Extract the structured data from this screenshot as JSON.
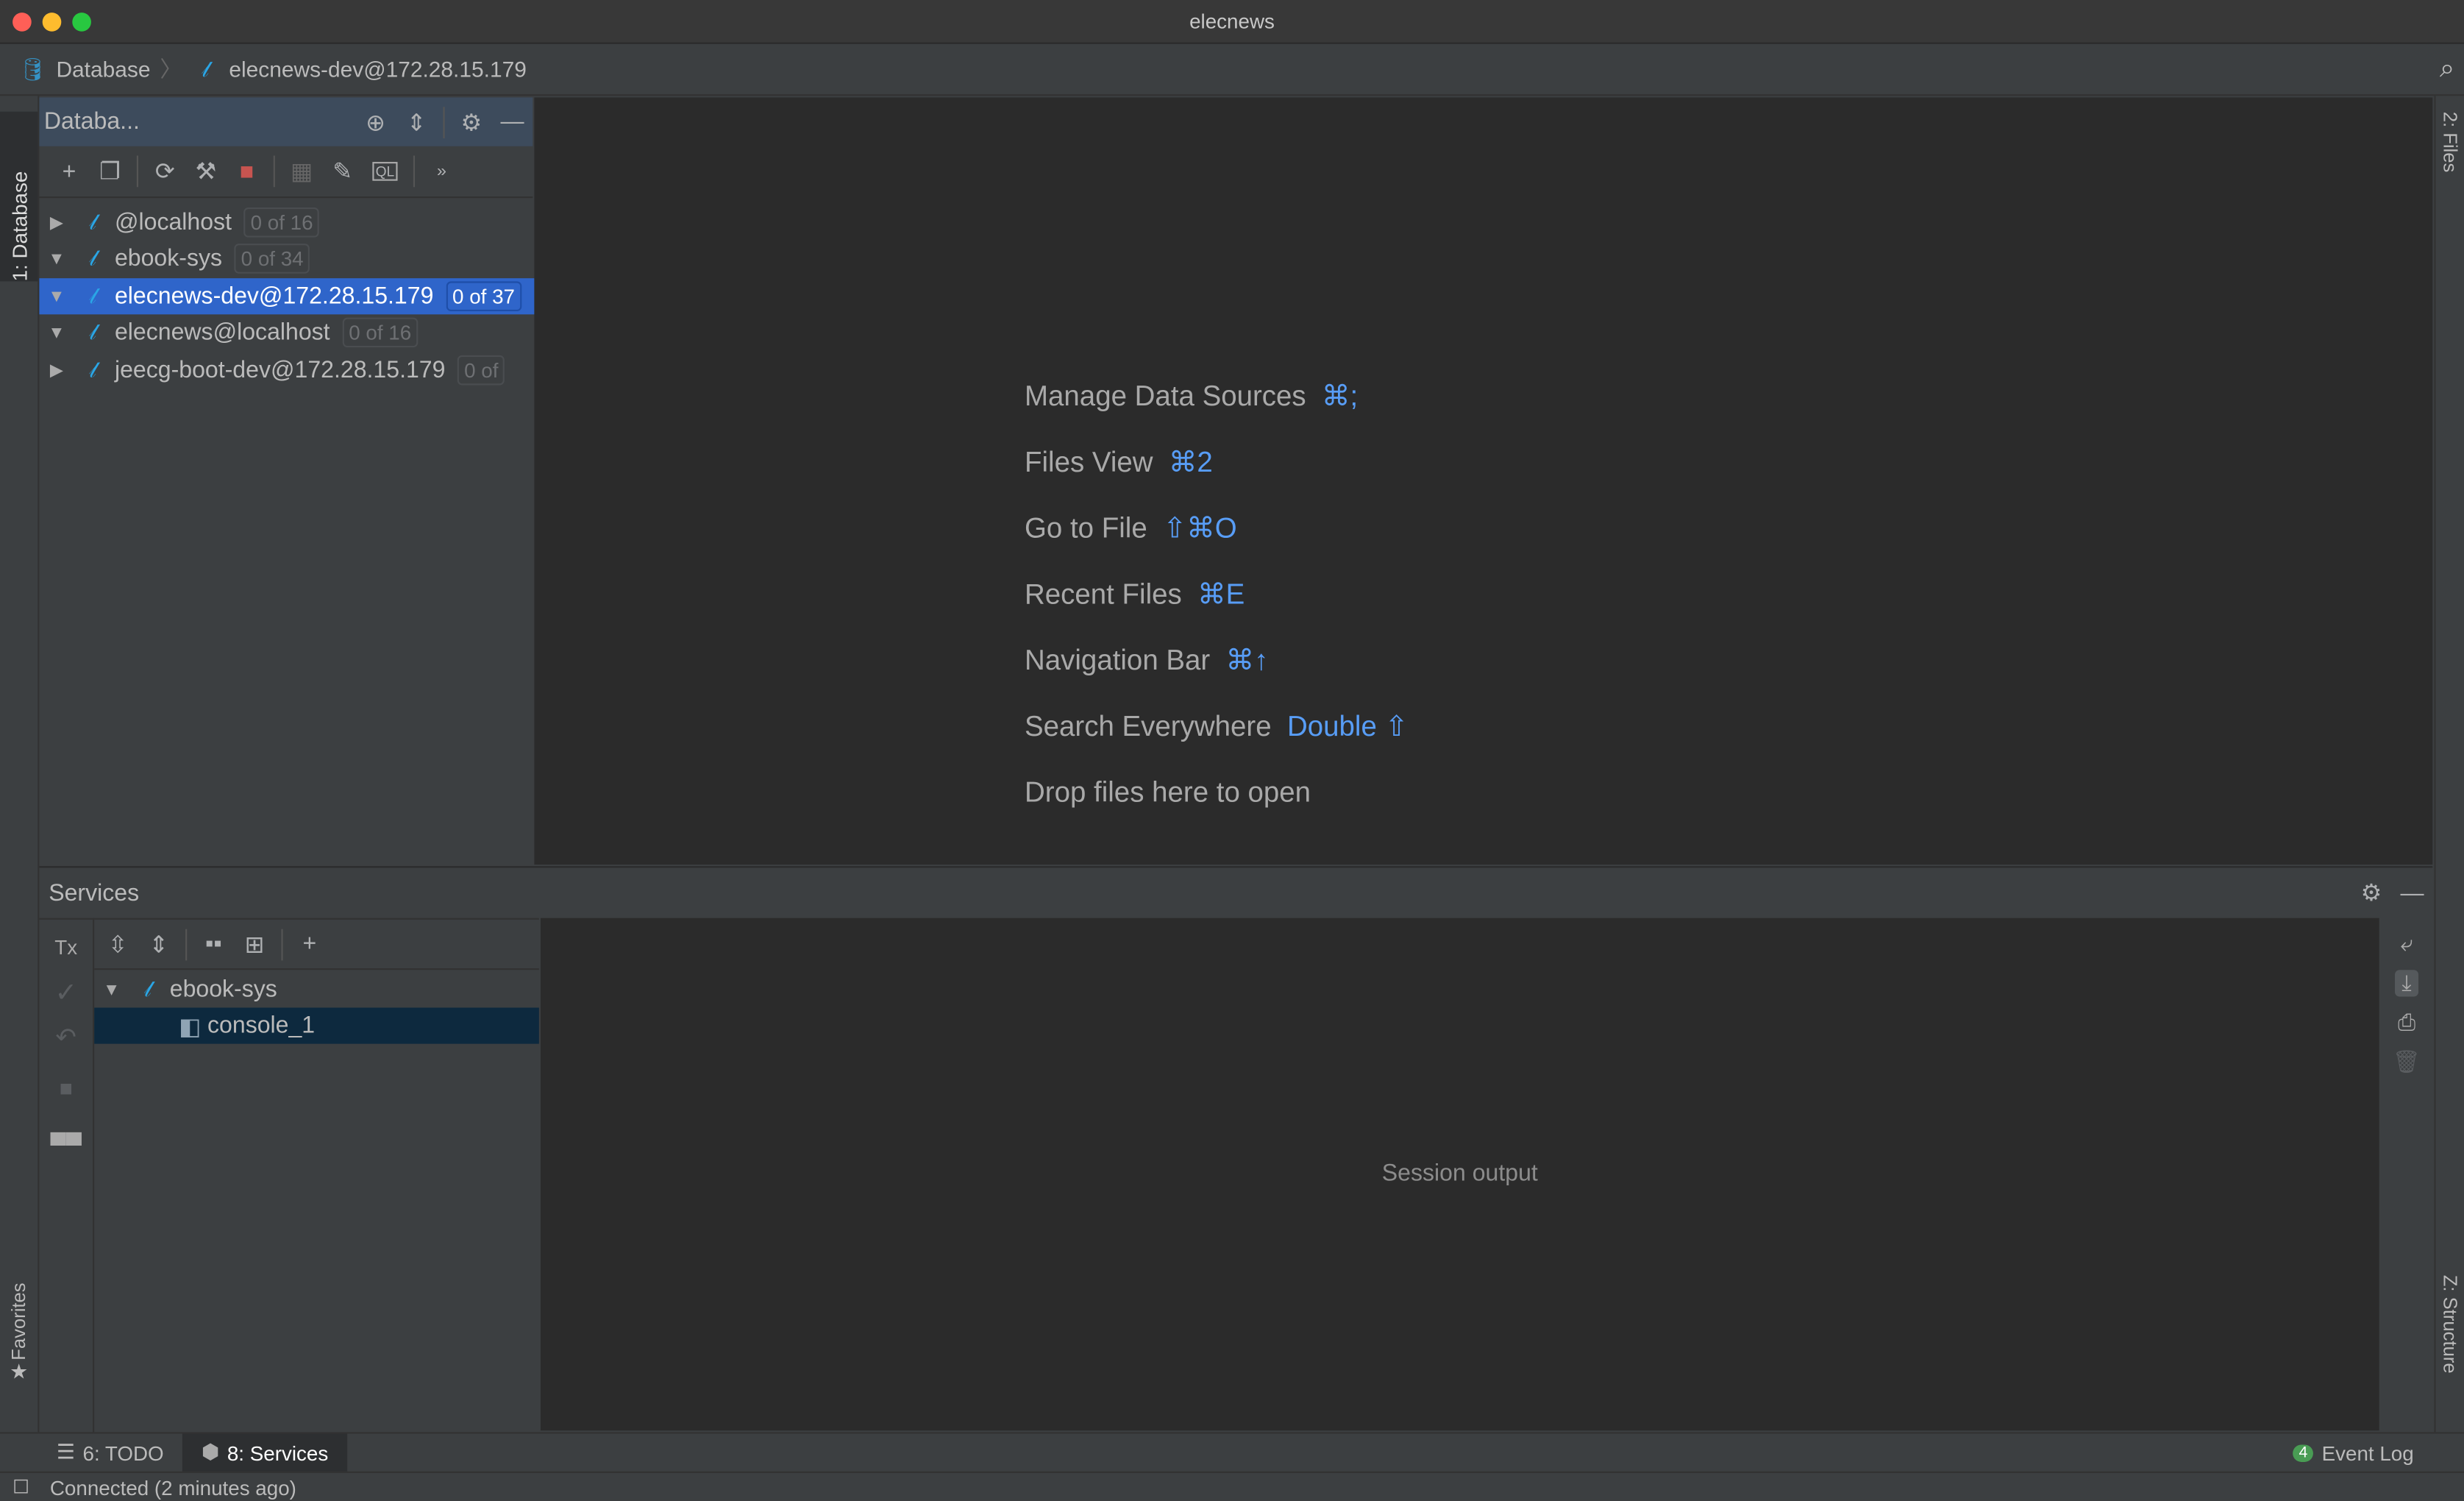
{
  "window": {
    "title": "elecnews"
  },
  "navbar": {
    "crumbs": [
      "Database",
      "elecnews-dev@172.28.15.179"
    ]
  },
  "left_stripe": {
    "database_tab": "1: Database",
    "favorites_tab": "Favorites"
  },
  "right_stripe": {
    "files_tab": "2: Files",
    "structure_tab": "Z: Structure"
  },
  "db_panel": {
    "title": "Databa...",
    "tree": [
      {
        "label": "@localhost",
        "badge": "0 of 16",
        "expanded": false,
        "selected": false
      },
      {
        "label": "ebook-sys",
        "badge": "0 of 34",
        "expanded": true,
        "selected": false
      },
      {
        "label": "elecnews-dev@172.28.15.179",
        "badge": "0 of 37",
        "expanded": true,
        "selected": true
      },
      {
        "label": "elecnews@localhost",
        "badge": "0 of 16",
        "expanded": true,
        "selected": false
      },
      {
        "label": "jeecg-boot-dev@172.28.15.179",
        "badge": "0 of",
        "expanded": false,
        "selected": false
      }
    ]
  },
  "editor": {
    "hints": [
      {
        "label": "Manage Data Sources",
        "shortcut": "⌘;"
      },
      {
        "label": "Files View",
        "shortcut": "⌘2"
      },
      {
        "label": "Go to File",
        "shortcut": "⇧⌘O"
      },
      {
        "label": "Recent Files",
        "shortcut": "⌘E"
      },
      {
        "label": "Navigation Bar",
        "shortcut": "⌘↑"
      },
      {
        "label": "Search Everywhere",
        "shortcut": "Double ⇧"
      },
      {
        "label": "Drop files here to open",
        "shortcut": ""
      }
    ]
  },
  "services": {
    "title": "Services",
    "tx_label": "Tx",
    "tree": [
      {
        "label": "ebook-sys"
      },
      {
        "label": "console_1"
      }
    ],
    "output_placeholder": "Session output"
  },
  "bottom_tabs": {
    "todo": "6: TODO",
    "services": "8: Services",
    "event_log": "Event Log",
    "event_count": "4"
  },
  "status": {
    "text": "Connected (2 minutes ago)"
  },
  "colors": {
    "accent": "#589df6",
    "selection": "#2f65ca",
    "editor_bg": "#2b2b2b",
    "panel_bg": "#3c3f41"
  }
}
